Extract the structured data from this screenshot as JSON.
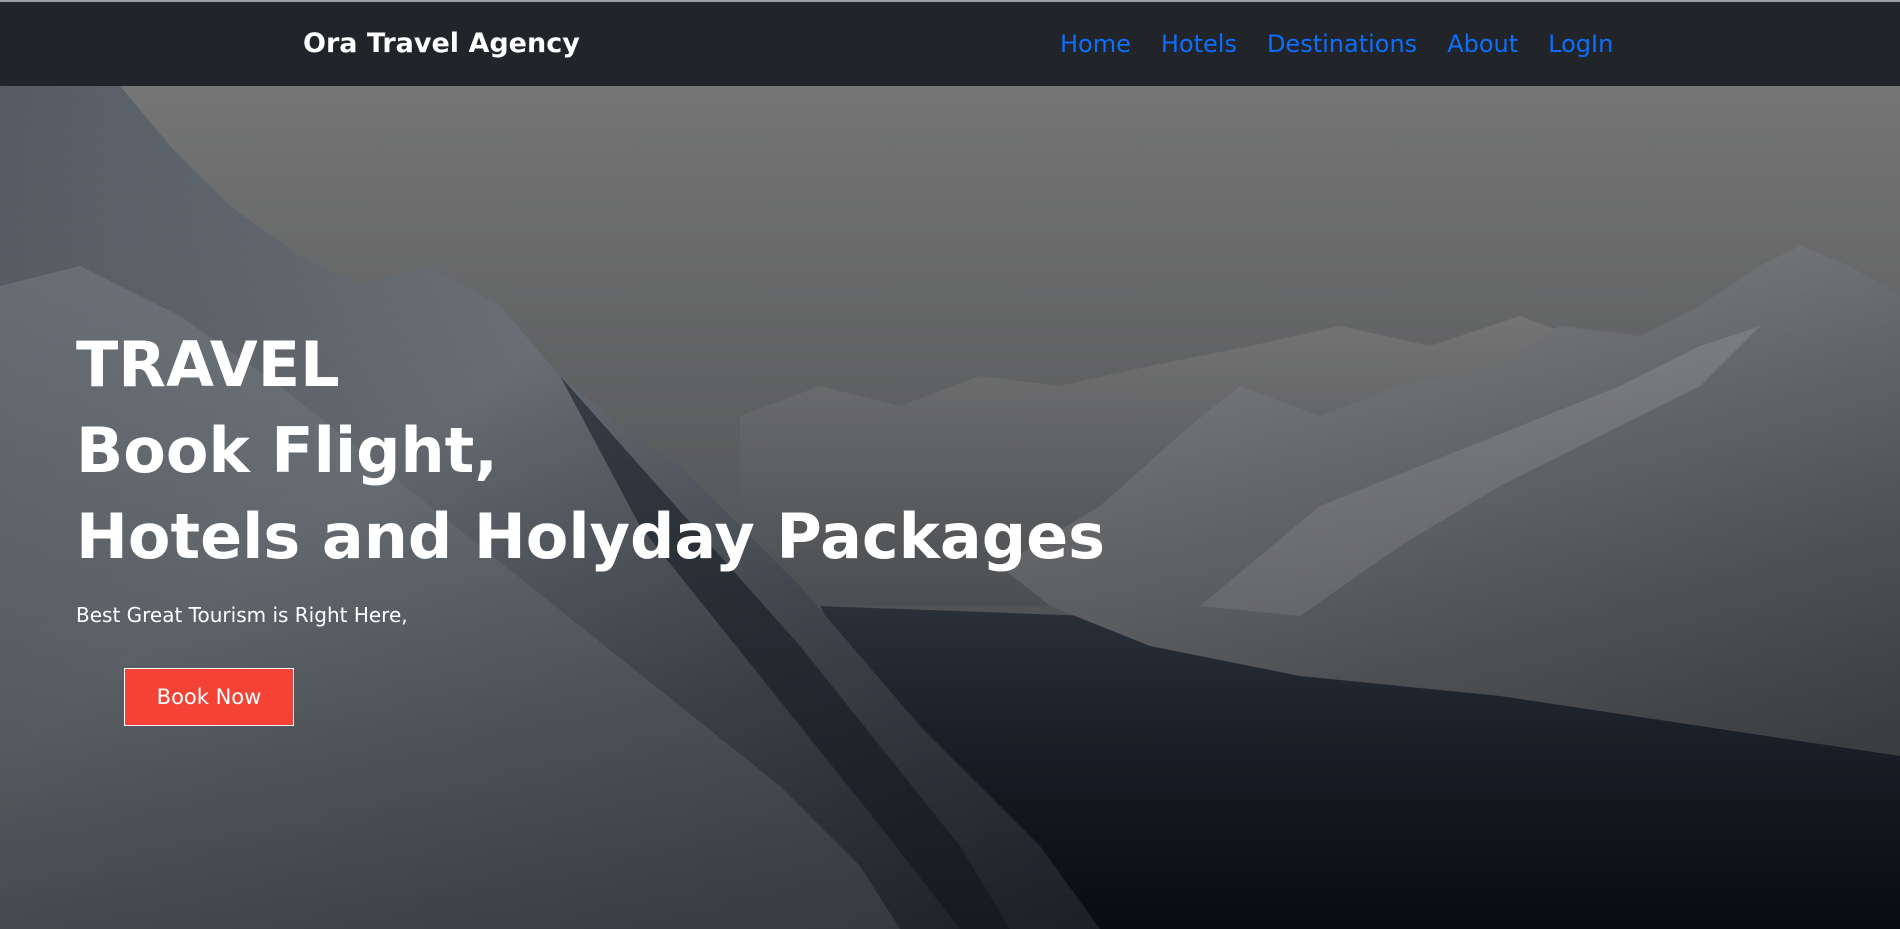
{
  "header": {
    "brand": "Ora Travel Agency",
    "nav": [
      "Home",
      "Hotels",
      "Destinations",
      "About",
      "LogIn"
    ]
  },
  "hero": {
    "title_lines": [
      "TRAVEL",
      "Book Flight,",
      "Hotels and Holyday Packages"
    ],
    "subtitle": "Best Great Tourism is Right Here,",
    "button_label": "Book Now"
  },
  "colors": {
    "navbar_bg": "#212529",
    "nav_link": "#0d6efd",
    "button_bg": "#f44336",
    "text": "#ffffff"
  }
}
